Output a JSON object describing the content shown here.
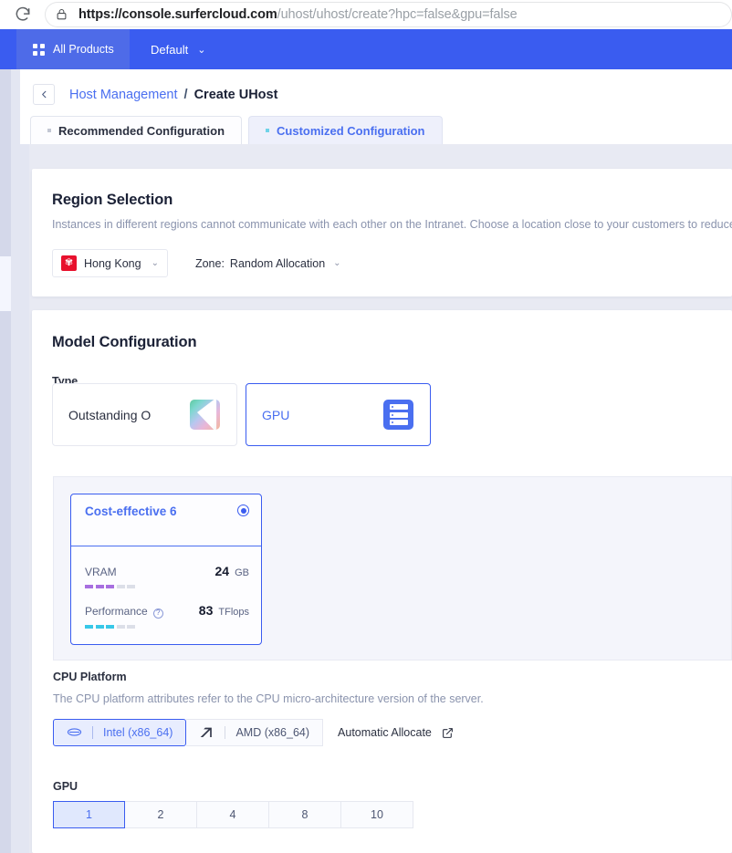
{
  "browser": {
    "reload_icon": "reload-icon",
    "lock_icon": "lock-icon",
    "url_scheme_host": "https://console.surfercloud.com",
    "url_path": "/uhost/uhost/create?hpc=false&gpu=false"
  },
  "topnav": {
    "all_products_label": "All Products",
    "grid_icon": "grid-icon",
    "project_label": "Default",
    "chevron_icon": "chevron-down-icon",
    "background_color": "#3a5cf0"
  },
  "breadcrumb": {
    "back_icon": "chevron-left-icon",
    "parent": "Host Management",
    "separator": "/",
    "current": "Create UHost"
  },
  "tabs": [
    {
      "label": "Recommended Configuration",
      "active": false
    },
    {
      "label": "Customized Configuration",
      "active": true
    }
  ],
  "region": {
    "title": "Region Selection",
    "description": "Instances in different regions cannot communicate with each other on the Intranet. Choose a location close to your customers to reduce netw",
    "selected_region": "Hong Kong",
    "flag_icon": "hong-kong-flag-icon",
    "zone_label": "Zone:",
    "zone_value": "Random Allocation"
  },
  "model": {
    "title": "Model Configuration",
    "type_label": "Type",
    "types": [
      {
        "label": "Outstanding O",
        "icon": "gradient-cube-icon",
        "selected": false
      },
      {
        "label": "GPU",
        "icon": "server-rack-icon",
        "selected": true
      }
    ],
    "gpu_model": {
      "name": "Cost-effective 6",
      "selected": true,
      "radio_icon": "radio-selected-icon",
      "specs": [
        {
          "name": "VRAM",
          "value": "24",
          "unit": "GB",
          "level": 3,
          "max": 5,
          "color": "#a86fe0",
          "has_help": false
        },
        {
          "name": "Performance",
          "value": "83",
          "unit": "TFlops",
          "level": 3,
          "max": 5,
          "color": "#38c8e8",
          "has_help": true,
          "help_icon": "question-mark-icon"
        }
      ]
    },
    "cpu_platform": {
      "label": "CPU Platform",
      "description": "The CPU platform attributes refer to the CPU micro-architecture version of the server.",
      "options": [
        {
          "label": "Intel (x86_64)",
          "icon": "intel-logo-icon",
          "selected": true
        },
        {
          "label": "AMD (x86_64)",
          "icon": "amd-logo-icon",
          "selected": false
        }
      ],
      "automatic_allocate_label": "Automatic Allocate",
      "automatic_allocate_icon": "external-link-icon"
    },
    "gpu_count": {
      "label": "GPU",
      "options": [
        "1",
        "2",
        "4",
        "8",
        "10"
      ],
      "selected": "1"
    }
  },
  "colors": {
    "accent": "#3a5cf0",
    "accent_text": "#4a6ff0",
    "page_bg": "#e8eaf3",
    "flag_red": "#e8112d"
  }
}
